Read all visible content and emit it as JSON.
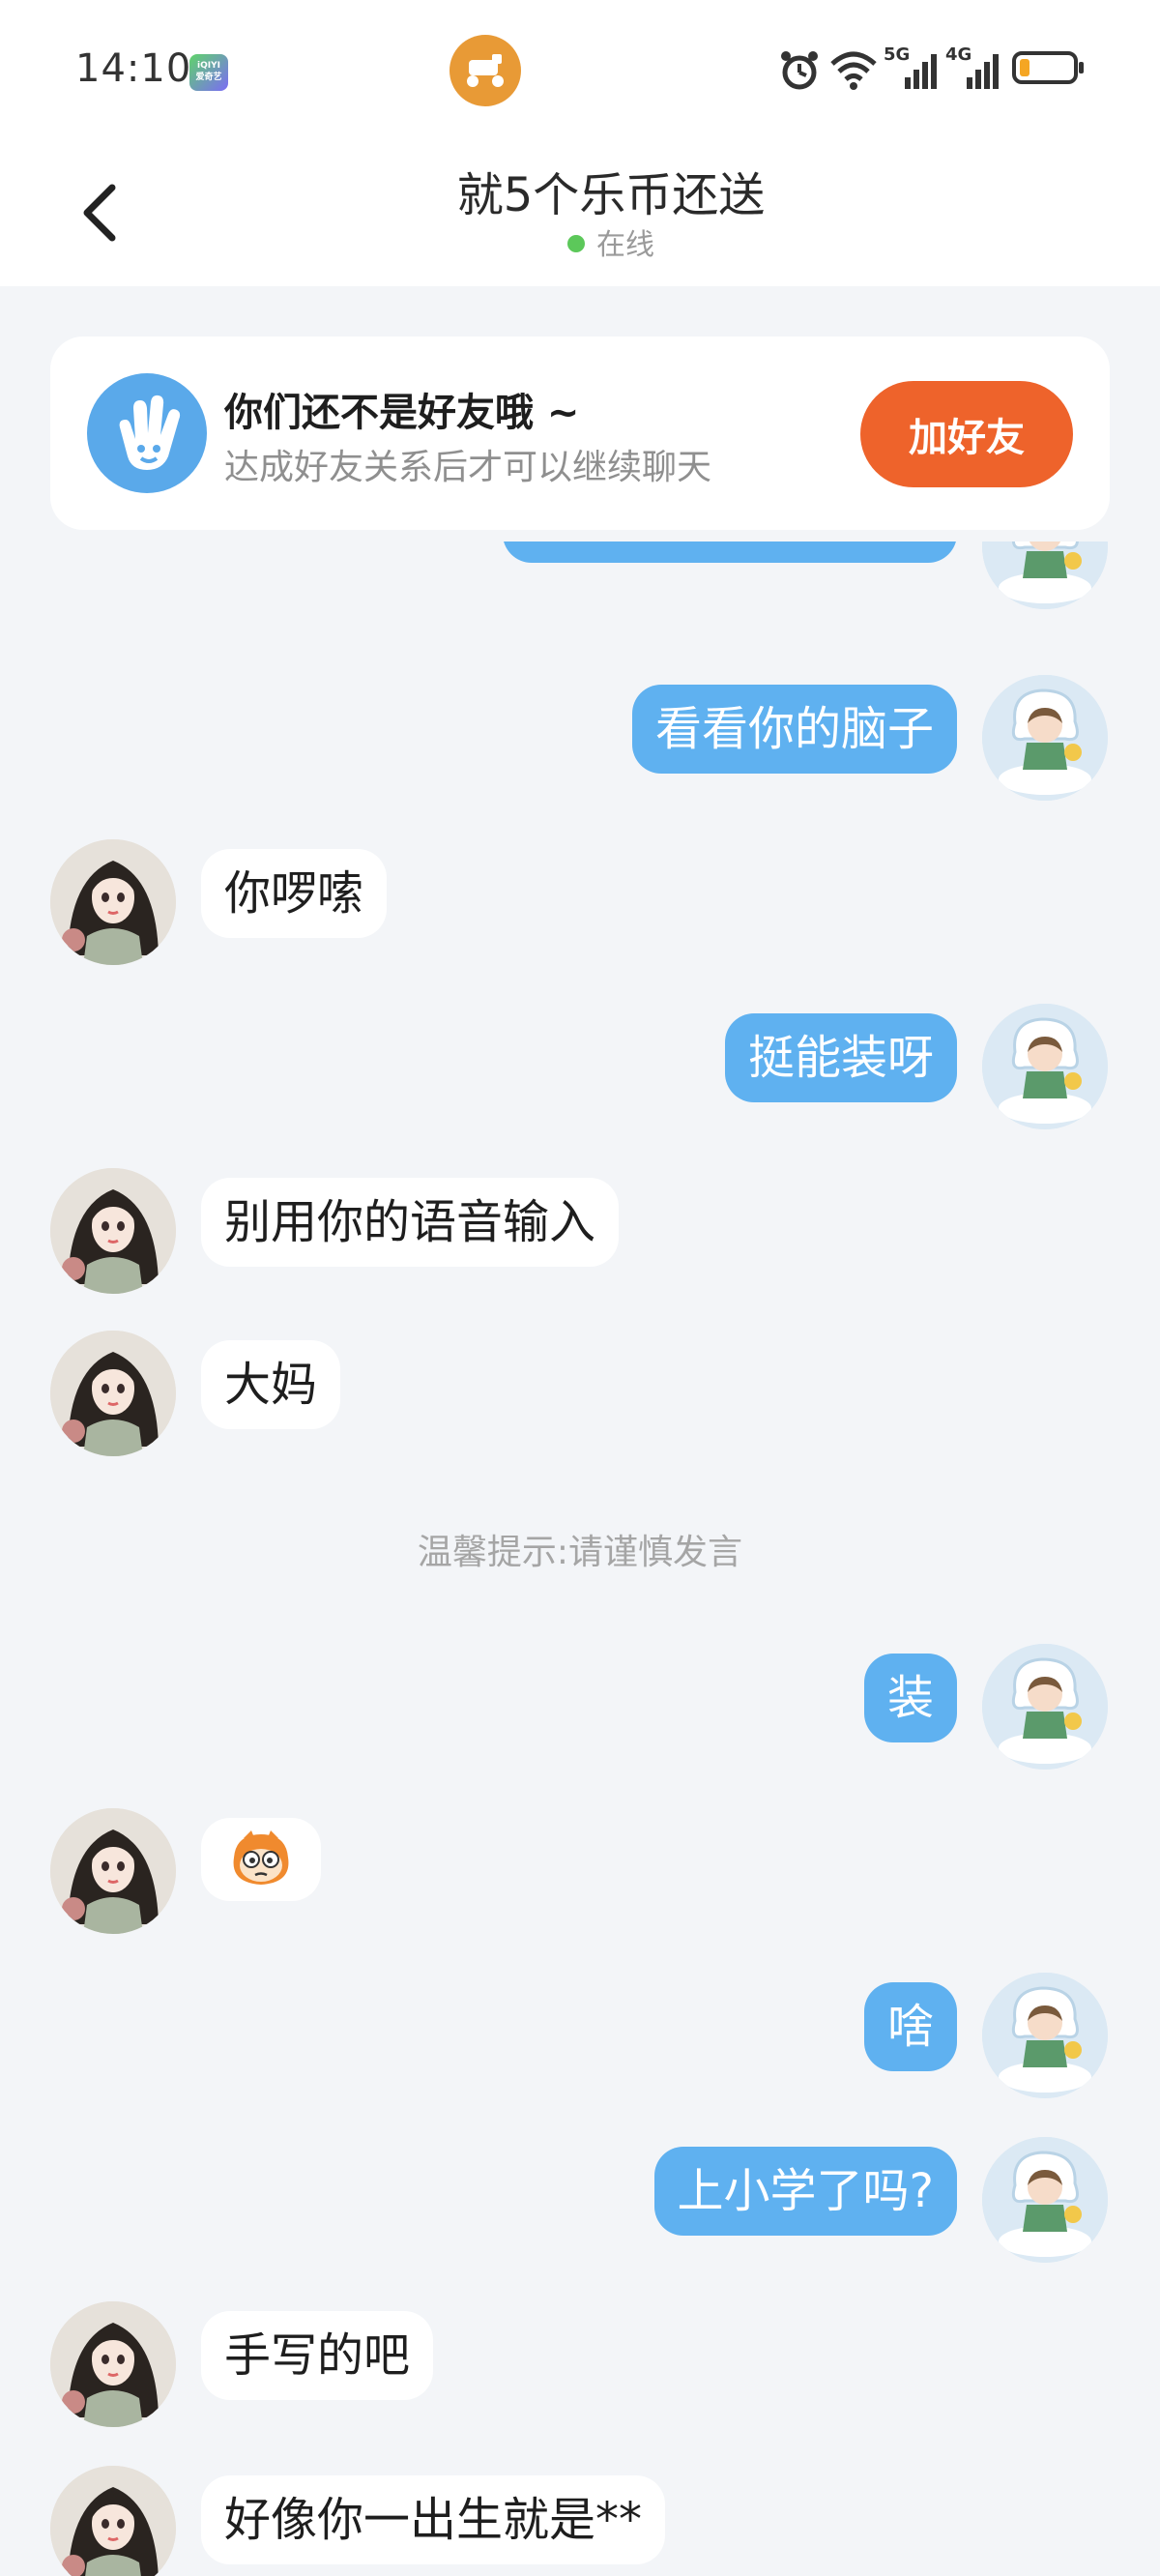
{
  "status_bar": {
    "time": "14:10",
    "app_badge": "iQIYI 爱奇艺",
    "network_5g": "5G",
    "network_4g": "4G",
    "icons": [
      "alarm-icon",
      "wifi-icon",
      "signal-5g-icon",
      "signal-4g-icon",
      "battery-icon"
    ],
    "battery_level": 0.2
  },
  "header": {
    "title": "就5个乐币还送",
    "status": "在线"
  },
  "friend_notice": {
    "title": "你们还不是好友哦 ~",
    "subtitle": "达成好友关系后才可以继续聊天",
    "button": "加好友"
  },
  "messages": [
    {
      "side": "me",
      "text": "看看你的脑子"
    },
    {
      "side": "other",
      "text": "你啰嗦"
    },
    {
      "side": "me",
      "text": "挺能装呀"
    },
    {
      "side": "other",
      "text": "别用你的语音输入"
    },
    {
      "side": "other",
      "text": "大妈"
    },
    {
      "side": "me",
      "text": "装"
    },
    {
      "side": "other",
      "emoji": "monkey-face-emoji"
    },
    {
      "side": "me",
      "text": "啥"
    },
    {
      "side": "me",
      "text": "上小学了吗?"
    },
    {
      "side": "other",
      "text": "手写的吧"
    },
    {
      "side": "other",
      "text": "好像你一出生就是**"
    }
  ],
  "tip": "温馨提示:请谨慎发言",
  "colors": {
    "accent_blue": "#5fb1f0",
    "add_button": "#ee632b",
    "online": "#5cc85a",
    "background": "#f3f5f8"
  }
}
